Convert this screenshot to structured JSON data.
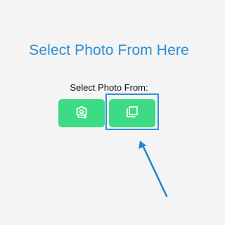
{
  "screen": {
    "title": "Select Photo From Here",
    "subtitle": "Select Photo From:"
  },
  "buttons": [
    {
      "icon": "camera-switch-icon"
    },
    {
      "icon": "copy-gallery-icon"
    }
  ],
  "colors": {
    "title": "#2b8fd6",
    "button": "#3ddc84",
    "highlight": "#2f8fd8",
    "background": "#f4f4f4"
  }
}
